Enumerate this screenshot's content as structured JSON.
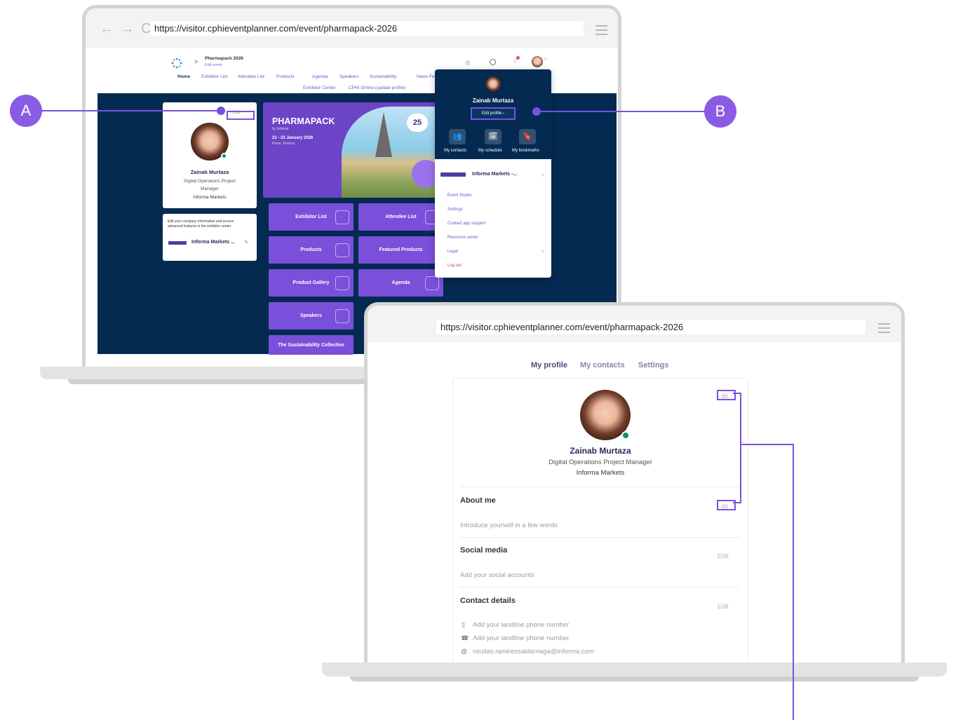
{
  "laptop1": {
    "url": "https://visitor.cphieventplanner.com/event/pharmapack-2026",
    "breadcrumb_title": "Pharmapack 2026",
    "breadcrumb_sub": "Edit event",
    "nav": [
      "Home",
      "Exhibitor List",
      "Attendee List",
      "Products",
      "Agenda",
      "Speakers",
      "Sustainability",
      "News Fe"
    ],
    "nav_row2": [
      "Exhibitor Center",
      "CPHI Online (update profile)"
    ],
    "profile_card": {
      "edit": "Edit",
      "name": "Zainab Murtaza",
      "role_line1": "Digital Operations Project",
      "role_line2": "Manager",
      "company": "Informa Markets"
    },
    "exhibitor_card": {
      "text_line1": "Edit your company information and access",
      "text_line2": "advanced features in the exhibitor center.",
      "company": "Informa Markets ..."
    },
    "hero": {
      "brand": "PHARMAPACK",
      "sub": "by informa",
      "dates": "21 - 22 January 2026",
      "city": "Paris, France",
      "badge": "25"
    },
    "tiles": [
      "Exhibitor List",
      "Attendee List",
      "Products",
      "Featured Products",
      "Product Gallery",
      "Agenda",
      "Speakers",
      "The Sustainability Collective"
    ],
    "dropdown": {
      "name": "Zainab Murtaza",
      "edit_profile": "Edit profile",
      "quick": [
        "My contacts",
        "My schedule",
        "My bookmarks"
      ],
      "company": "Informa Markets -...",
      "items": [
        "Event Studio",
        "Settings",
        "Contact app support",
        "Resource center",
        "Legal",
        "Log out"
      ]
    }
  },
  "callouts": {
    "a": "A",
    "b": "B"
  },
  "laptop2": {
    "url": "https://visitor.cphieventplanner.com/event/pharmapack-2026",
    "tabs": [
      "My profile",
      "My contacts",
      "Settings"
    ],
    "profile": {
      "edit_top": "dit",
      "name": "Zainab Murtaza",
      "role": "Digital Operations Project Manager",
      "company": "Informa Markets"
    },
    "about": {
      "title": "About me",
      "edit": "dit",
      "placeholder": "Introduce yourself in a few words"
    },
    "social": {
      "title": "Social media",
      "edit": "Edit",
      "placeholder": "Add your social accounts"
    },
    "contact": {
      "title": "Contact details",
      "edit": "Edit",
      "lines": [
        "Add your landline phone number",
        "Add your landline phone number",
        "nicolas.ramirezsaldarriaga@informa.com"
      ]
    }
  },
  "colors": {
    "accent": "#7b50e0",
    "banner": "#042a52",
    "tile": "#7a4fd9",
    "online": "#0a8f74"
  }
}
